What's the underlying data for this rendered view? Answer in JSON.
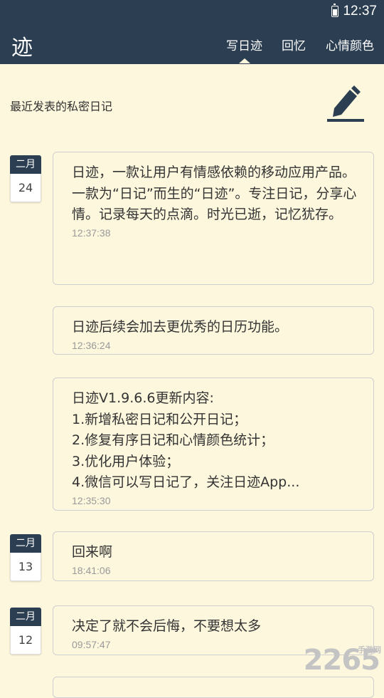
{
  "status_bar": {
    "time": "12:37"
  },
  "toolbar": {
    "logo": "迹",
    "tabs": [
      "写日迹",
      "回忆",
      "心情颜色"
    ]
  },
  "section_title": "最近发表的私密日记",
  "date_badges": [
    {
      "month": "二月",
      "day": "24"
    },
    {
      "month": "二月",
      "day": "13"
    },
    {
      "month": "二月",
      "day": "12"
    }
  ],
  "entries": [
    {
      "text": "日迹，一款让用户有情感依赖的移动应用产品。\n一款为“日记”而生的“日迹”。专注日记，分享心情。记录每天的点滴。时光已逝，记忆犹存。",
      "time": "12:37:38"
    },
    {
      "text": "日迹后续会加去更优秀的日历功能。",
      "time": "12:36:24"
    },
    {
      "text": "日迹V1.9.6.6更新内容:\n1.新增私密日记和公开日记；\n2.修复有序日记和心情颜色统计；\n3.优化用户体验；\n4.微信可以写日记了，关注日迹App...",
      "time": "12:35:30"
    },
    {
      "text": "回来啊",
      "time": "18:41:06"
    },
    {
      "text": "决定了就不会后悔，不要想太多",
      "time": "09:57:47"
    }
  ],
  "watermark": {
    "main": "2265",
    "small": "手游网"
  },
  "colors": {
    "header": "#2b3e52",
    "background": "#fdf7dd"
  }
}
